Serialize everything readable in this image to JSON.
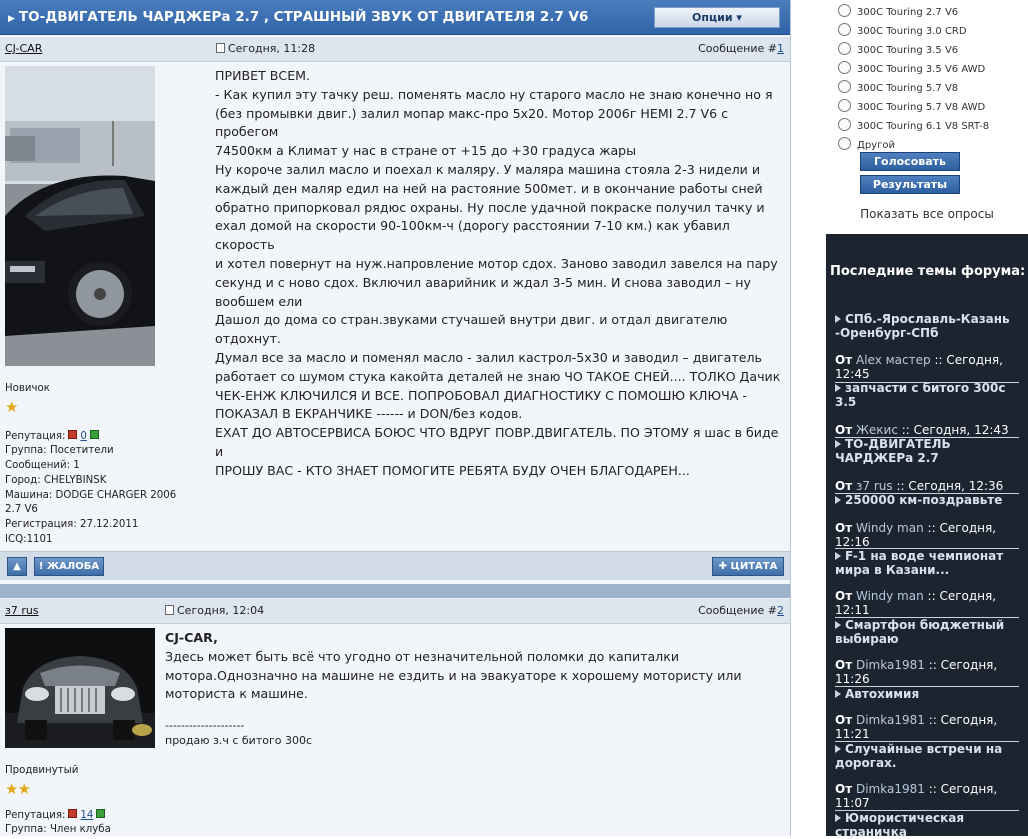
{
  "topic": {
    "title": "ТО-ДВИГАТЕЛЬ ЧАРДЖЕРа 2.7 , СТРАШНЫЙ ЗВУК ОТ ДВИГАТЕЛЯ 2.7 V6",
    "options_label": "Опции"
  },
  "posts": [
    {
      "author": "CJ-CAR",
      "date": "Сегодня, 11:28",
      "number_label": "Сообщение #",
      "number": "1",
      "rank": "Новичок",
      "stars": "★",
      "reputation_label": "Репутация:",
      "reputation": "0",
      "info": [
        "Группа: Посетители",
        "Сообщений: 1",
        "Город: CHELYBINSK",
        "Машина: DODGE CHARGER 2006",
        "2.7 V6",
        "Регистрация: 27.12.2011",
        "ICQ:1101"
      ],
      "text": [
        "ПРИВЕТ ВСЕМ.",
        "- Как купил эту тачку реш. поменять масло ну старого масло не знаю конечно но я",
        "(без промывки двиг.) залил мопар макс-про 5х20. Мотор 2006г HEMI 2.7 V6 с пробегом",
        "74500км а Климат у нас в стране от +15 до +30 градуса жары",
        "Ну короче залил масло и поехал к маляру. У маляра машина стояла 2-3 нидели и",
        "каждый ден маляр едил на ней на растояние 500мет. и в окончание работы сней",
        "обратно припорковал рядюс охраны. Ну после удачной покраске получил тачку и",
        "ехал домой на скорости 90-100км-ч (дорогу расстоянии 7-10 км.) как убавил скорость",
        "и хотел повернут на нуж.напровление мотор сдох. Заново заводил завелся на пару",
        "секунд и с ново сдох. Включил аварийник и ждал 3-5 мин. И снова заводил – ну",
        "вообшем ели",
        "Дашол до дома со стран.звуками стучашей внутри двиг. и отдал двигателю отдохнут.",
        "Думал все за масло и поменял масло - залил кастрол-5х30 и заводил – двигатель",
        "работает со шумом стука какойта деталей не знаю ЧО ТАКОЕ СНЕЙ.... ТОЛКО Дачик",
        "ЧЕК-ЕНЖ КЛЮЧИЛСЯ И ВСЕ. ПОПРОБОВАЛ ДИАГНОСТИКУ С ПОМОШЮ КЛЮЧА -",
        "ПОКАЗАЛ В ЕКРАНЧИКЕ ------ и DON/без кодов.",
        "ЕХАТ ДО АВТОСЕРВИСА БОЮС ЧТО ВДРУГ ПОВР.ДВИГАТЕЛЬ. ПО ЭТОМУ я шас в биде и",
        "ПРОШУ ВАС - КТО ЗНАЕТ ПОМОГИТЕ РЕБЯТА БУДУ ОЧЕН БЛАГОДАРЕН..."
      ],
      "buttons": {
        "report": "ЖАЛОБА",
        "quote": "ЦИТАТА"
      }
    },
    {
      "author": "з7 rus",
      "date": "Сегодня, 12:04",
      "number_label": "Сообщение #",
      "number": "2",
      "rank": "Продвинутый",
      "stars": "★★",
      "reputation_label": "Репутация:",
      "reputation": "14",
      "info": [
        "Группа: Член клуба"
      ],
      "quote_name": "CJ-CAR,",
      "text": [
        "Здесь может быть всё что угодно от незначительной поломки до капиталки",
        "мотора.Однозначно на машине не ездить и на эвакуаторе к хорошему мотористу или",
        "моториста к машине."
      ],
      "signature_sep": "--------------------",
      "signature": "продаю з.ч с битого 300с"
    }
  ],
  "poll": {
    "options": [
      "300C Touring 2.7 V6",
      "300C Touring 3.0 CRD",
      "300C Touring 3.5 V6",
      "300C Touring 3.5 V6 AWD",
      "300C Touring 5.7 V8",
      "300C Touring 5.7 V8 AWD",
      "300C Touring 6.1 V8 SRT-8",
      "Другой"
    ],
    "vote_label": "Голосовать",
    "results_label": "Результаты",
    "show_all": "Показать все опросы"
  },
  "latest": {
    "heading": "Последние темы форума:",
    "from_label": "От",
    "topics": [
      {
        "title": [
          "СПб.-Ярославль-Казань",
          "-Оренбург-СПб"
        ],
        "author": "Alex мастер",
        "time": ":: Сегодня,",
        "time2": "12:45"
      },
      {
        "title": [
          "запчасти с битого 300с",
          "3.5"
        ],
        "author": "Жекис",
        "time": ":: Сегодня, 12:43",
        "time2": ""
      },
      {
        "title": [
          "ТО-ДВИГАТЕЛЬ",
          "ЧАРДЖЕРа 2.7"
        ],
        "author": "з7 rus",
        "time": ":: Сегодня, 12:36",
        "time2": ""
      },
      {
        "title": [
          "250000 км-поздравьте"
        ],
        "author": "Windy man",
        "time": ":: Сегодня,",
        "time2": "12:16"
      },
      {
        "title": [
          "F-1 на воде чемпионат",
          "мира в Казани..."
        ],
        "author": "Windy man",
        "time": ":: Сегодня,",
        "time2": "12:11"
      },
      {
        "title": [
          "Смартфон бюджетный",
          "выбираю"
        ],
        "author": "Dimka1981",
        "time": ":: Сегодня,",
        "time2": "11:26"
      },
      {
        "title": [
          "Автохимия"
        ],
        "author": "Dimka1981",
        "time": ":: Сегодня,",
        "time2": "11:21"
      },
      {
        "title": [
          "Случайные встречи на",
          "дорогах."
        ],
        "author": "Dimka1981",
        "time": ":: Сегодня,",
        "time2": "11:07"
      },
      {
        "title": [
          "Юмористическая",
          "страничка"
        ],
        "author": "",
        "time": "",
        "time2": ""
      }
    ]
  }
}
